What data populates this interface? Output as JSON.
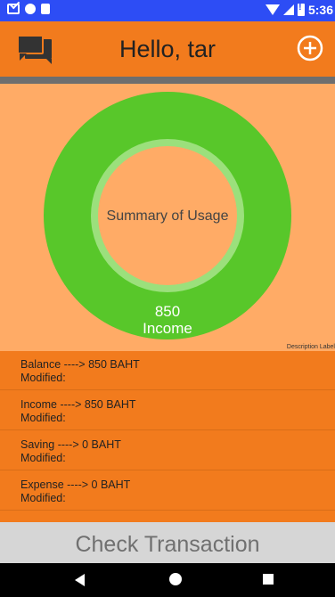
{
  "status_bar": {
    "time": "5:36",
    "icons": [
      "gmail-icon",
      "circle-icon",
      "card-icon",
      "wifi-icon",
      "signal-icon",
      "battery-icon"
    ]
  },
  "app_bar": {
    "title": "Hello, tar",
    "left_icon": "chat-icon",
    "right_icon": "add-circle-icon"
  },
  "chart_data": {
    "type": "pie",
    "title": "",
    "center_text": "Summary of Usage",
    "description": "Description Label",
    "slices": [
      {
        "label": "Income",
        "value": 850,
        "color": "#58C72A"
      }
    ],
    "hole_color": "#FFAB66",
    "ring_inner_color": "#9BE07C"
  },
  "items": [
    {
      "title": "Balance ----> 850 BAHT",
      "modified": "Modified:"
    },
    {
      "title": "Income ----> 850 BAHT",
      "modified": "Modified:"
    },
    {
      "title": "Saving ----> 0 BAHT",
      "modified": "Modified:"
    },
    {
      "title": "Expense ----> 0 BAHT",
      "modified": "Modified:"
    }
  ],
  "check_button": {
    "label": "Check Transaction"
  },
  "colors": {
    "status_bar": "#2D4DF5",
    "app_bar": "#F27B1D",
    "background": "#FFAB66",
    "donut": "#58C72A",
    "button": "#D6D6D6"
  },
  "nav": [
    "back-icon",
    "home-icon",
    "recent-apps-icon"
  ]
}
